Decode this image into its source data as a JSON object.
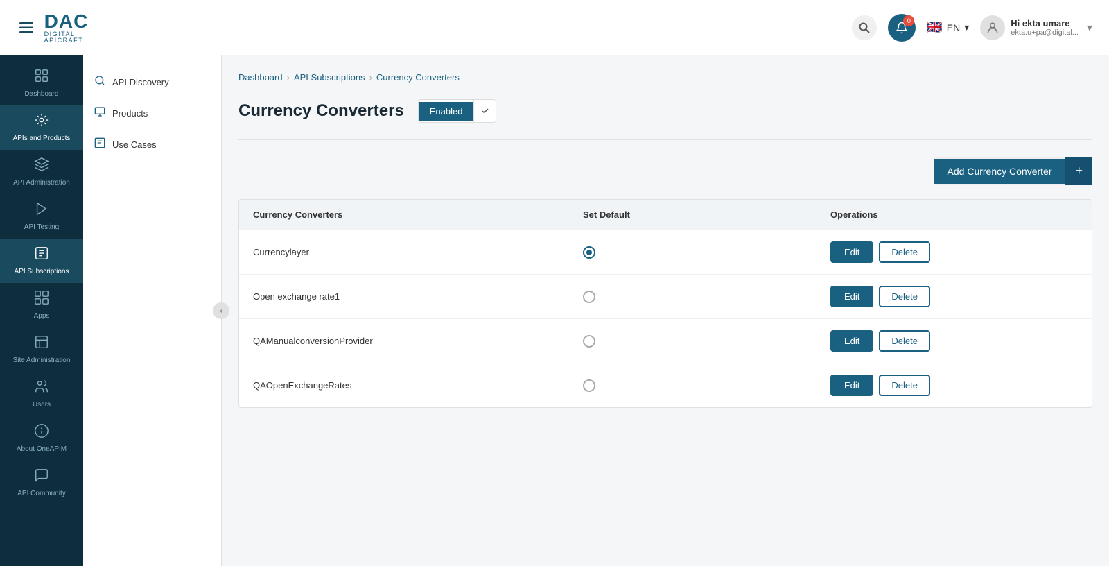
{
  "header": {
    "hamburger_label": "☰",
    "logo_main": "DAC",
    "logo_sub": "DIGITAL APICRAFT",
    "search_placeholder": "Search",
    "notif_count": "0",
    "language": "EN",
    "flag_emoji": "🇬🇧",
    "user_name": "Hi ekta umare",
    "user_email": "ekta.u+pa@digital...",
    "chevron_down": "▾"
  },
  "left_nav": {
    "items": [
      {
        "id": "dashboard",
        "icon": "⊞",
        "label": "Dashboard"
      },
      {
        "id": "apis-products",
        "icon": "⊡",
        "label": "APIs and Products",
        "active": true
      },
      {
        "id": "api-administration",
        "icon": "⚙",
        "label": "API Administration"
      },
      {
        "id": "api-testing",
        "icon": "▶",
        "label": "API Testing"
      },
      {
        "id": "api-subscriptions",
        "icon": "◈",
        "label": "API Subscriptions",
        "active": true
      },
      {
        "id": "apps",
        "icon": "▣",
        "label": "Apps"
      },
      {
        "id": "site-administration",
        "icon": "⊟",
        "label": "Site Administration"
      },
      {
        "id": "users",
        "icon": "👤",
        "label": "Users"
      },
      {
        "id": "about",
        "icon": "ℹ",
        "label": "About OneAPIM"
      },
      {
        "id": "community",
        "icon": "💬",
        "label": "API Community"
      }
    ]
  },
  "secondary_sidebar": {
    "items": [
      {
        "id": "api-discovery",
        "icon": "◈",
        "label": "API Discovery"
      },
      {
        "id": "products",
        "icon": "⊡",
        "label": "Products"
      },
      {
        "id": "use-cases",
        "icon": "◧",
        "label": "Use Cases"
      }
    ]
  },
  "breadcrumb": {
    "items": [
      {
        "label": "Dashboard",
        "link": true
      },
      {
        "label": "API Subscriptions",
        "link": true
      },
      {
        "label": "Currency Converters",
        "link": false,
        "active": true
      }
    ]
  },
  "page": {
    "title": "Currency Converters",
    "toggle_label": "Enabled",
    "add_button_label": "Add Currency Converter",
    "add_button_plus": "+",
    "table": {
      "headers": [
        "Currency Converters",
        "Set Default",
        "Operations"
      ],
      "rows": [
        {
          "name": "Currencylayer",
          "selected": true
        },
        {
          "name": "Open exchange rate1",
          "selected": false
        },
        {
          "name": "QAManualconversionProvider",
          "selected": false
        },
        {
          "name": "QAOpenExchangeRates",
          "selected": false
        }
      ],
      "edit_label": "Edit",
      "delete_label": "Delete"
    }
  }
}
